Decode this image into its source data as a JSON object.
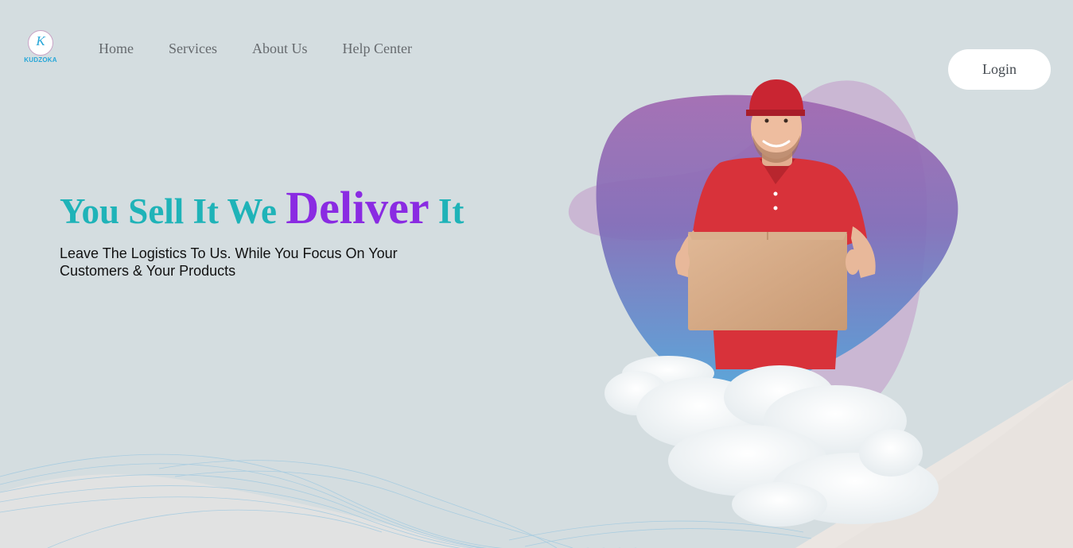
{
  "brand": {
    "logo_glyph": "K",
    "logo_text": "KUDZOKA"
  },
  "nav": {
    "items": [
      {
        "label": "Home"
      },
      {
        "label": "Services"
      },
      {
        "label": "About Us"
      },
      {
        "label": "Help Center"
      }
    ],
    "login_label": "Login"
  },
  "hero": {
    "title_part1": "You Sell It We ",
    "title_highlight": "Deliver",
    "title_part2": " It",
    "subtitle": "Leave The Logistics To Us. While You Focus On Your Customers & Your Products"
  },
  "colors": {
    "background": "#d4dde0",
    "title_teal": "#1fb3b8",
    "title_purple": "#8a2be2",
    "blob_purple": "#9b5fb0",
    "blob_blue": "#5a9ed6",
    "shirt_red": "#d8323a"
  },
  "illustration": {
    "subject": "delivery-man-holding-box-icon"
  }
}
